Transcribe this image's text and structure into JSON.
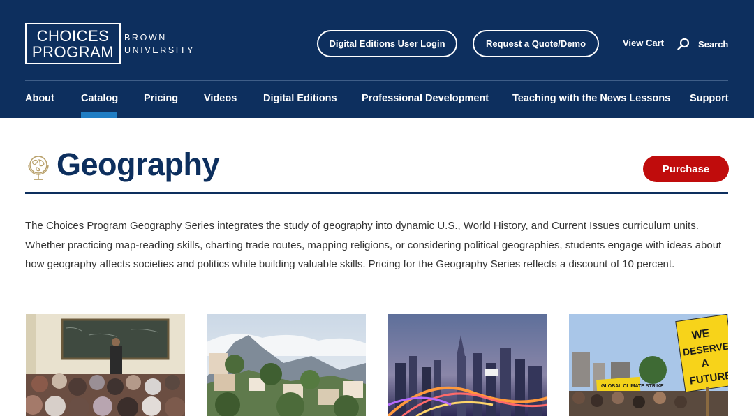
{
  "header": {
    "logo": {
      "line1": "CHOICES",
      "line2": "PROGRAM",
      "sub1": "BROWN",
      "sub2": "UNIVERSITY"
    },
    "login_button": "Digital Editions User Login",
    "quote_button": "Request a Quote/Demo",
    "cart_link": "View Cart",
    "search_link": "Search",
    "search_icon": "search-icon"
  },
  "nav": {
    "items": [
      "About",
      "Catalog",
      "Pricing",
      "Videos",
      "Digital Editions",
      "Professional Development",
      "Teaching with the News Lessons",
      "Support"
    ],
    "active": "Catalog"
  },
  "main": {
    "title_icon": "globe-icon",
    "title": "Geography",
    "purchase_button": "Purchase",
    "intro": "The Choices Program Geography Series integrates the study of geography into dynamic U.S., World History, and Current Issues curriculum units. Whether practicing map-reading skills, charting trade routes, mapping religions, or considering political geographies, students engage with ideas about how geography affects societies and politics while building valuable skills. Pricing for the Geography Series reflects a discount of 10 percent."
  },
  "thumbnails": {
    "protest_sign_1": "WE",
    "protest_sign_2": "DESERVE",
    "protest_sign_3": "A",
    "protest_sign_4": "FUTURE",
    "banner_text": "GLOBAL CLIMATE STRIKE"
  },
  "colors": {
    "header_bg": "#0d2f5e",
    "nav_active": "#1f7dc4",
    "purchase_bg": "#c00c0c",
    "title": "#0d2f5e"
  }
}
